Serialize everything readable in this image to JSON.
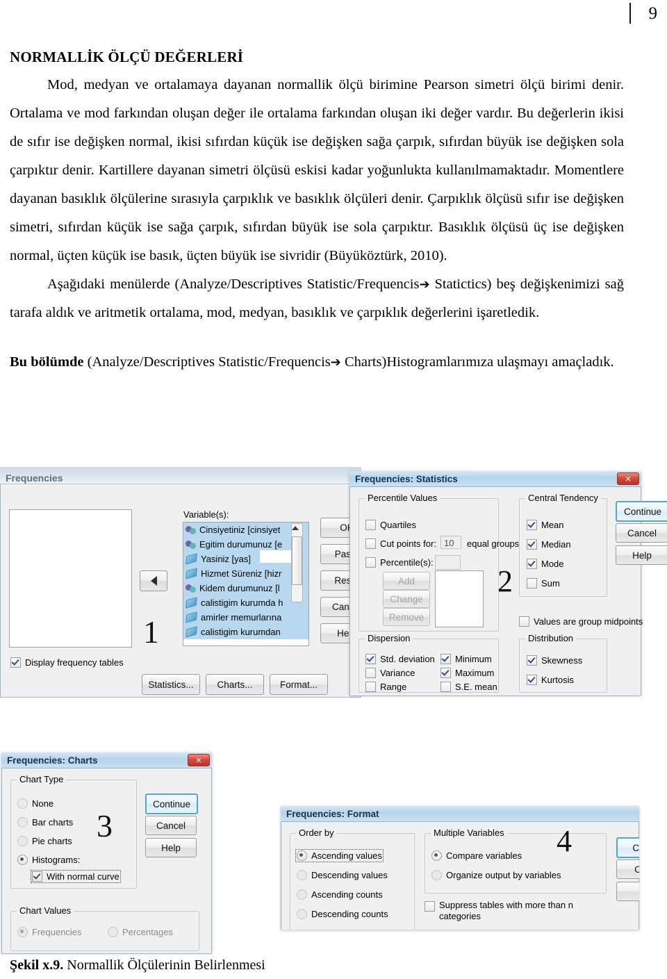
{
  "page": {
    "number": "9"
  },
  "document": {
    "title": "NORMALLİK ÖLÇÜ DEĞERLERİ",
    "paragraph1": "Mod, medyan ve ortalamaya dayanan normallik ölçü birimine Pearson simetri ölçü birimi denir. Ortalama ve mod farkından oluşan değer ile ortalama farkından oluşan iki değer vardır. Bu değerlerin ikisi de sıfır ise değişken normal, ikisi sıfırdan küçük ise değişken sağa çarpık, sıfırdan büyük ise değişken sola çarpıktır denir. Kartillere dayanan simetri ölçüsü eskisi kadar yoğunlukta kullanılmamaktadır. Momentlere dayanan basıklık ölçülerine sırasıyla çarpıklık ve basıklık ölçüleri denir. Çarpıklık ölçüsü sıfır ise değişken simetri, sıfırdan küçük ise sağa çarpık, sıfırdan büyük ise sola çarpıktır. Basıklık ölçüsü üç ise değişken normal, üçten küçük ise basık, üçten büyük ise sivridir (Büyüköztürk, 2010).",
    "paragraph2_part1": "Aşağıdaki menülerde (Analyze/Descriptives Statistic/Frequencis",
    "paragraph2_arrow": "➔",
    "paragraph2_part2": " Statictics) beş değişkenimizi sağ tarafa aldık ve aritmetik ortalama, mod, medyan, basıklık ve çarpıklık değerlerini işaretledik.",
    "paragraph3_bold": "Bu bölümde",
    "paragraph3_part1": " (Analyze/Descriptives   Statistic/Frequencis",
    "paragraph3_arrow": "➔",
    "paragraph3_part2": "   Charts)Histogramlarımıza ulaşmayı amaçladık."
  },
  "caption": {
    "bold": "Şekil x.9.",
    "text": " Normallik Ölçülerinin Belirlenmesi"
  },
  "frequencies_dialog": {
    "title": "Frequencies",
    "marker": "1",
    "variables_label": "Variable(s):",
    "variables": [
      {
        "label": "Cinsiyetiniz [cinsiyet",
        "icon": "nominal-icon"
      },
      {
        "label": "Egitim durumunuz [e",
        "icon": "nominal-icon"
      },
      {
        "label": "Yasiniz [yas]",
        "icon": "scale-icon"
      },
      {
        "label": "Hizmet Süreniz [hizr",
        "icon": "scale-icon"
      },
      {
        "label": "Kidem durumunuz [l",
        "icon": "nominal-icon"
      },
      {
        "label": "calistigim kurumda h",
        "icon": "scale-icon"
      },
      {
        "label": "amirler memurlarına",
        "icon": "scale-icon"
      },
      {
        "label": "calistigim kurumdan",
        "icon": "scale-icon"
      }
    ],
    "display_frequency_tables": {
      "label": "Display frequency tables",
      "checked": true
    },
    "side_buttons": [
      {
        "label": "OK"
      },
      {
        "label": "Paste"
      },
      {
        "label": "Reset"
      },
      {
        "label": "Cancel"
      },
      {
        "label": "Help"
      }
    ],
    "bottom_buttons": [
      {
        "label": "Statistics..."
      },
      {
        "label": "Charts..."
      },
      {
        "label": "Format..."
      }
    ]
  },
  "statistics_dialog": {
    "title": "Frequencies: Statistics",
    "marker": "2",
    "close_label": "✕",
    "percentile_values": {
      "group_label": "Percentile Values",
      "quartiles": {
        "label": "Quartiles",
        "checked": false
      },
      "cut_points": {
        "label": "Cut points for:",
        "value": "10",
        "suffix": "equal groups",
        "checked": false
      },
      "percentiles": {
        "label": "Percentile(s):",
        "value": "",
        "checked": false
      },
      "add_label": "Add",
      "change_label": "Change",
      "remove_label": "Remove"
    },
    "central_tendency": {
      "group_label": "Central Tendency",
      "items": [
        {
          "label": "Mean",
          "checked": true
        },
        {
          "label": "Median",
          "checked": true
        },
        {
          "label": "Mode",
          "checked": true
        },
        {
          "label": "Sum",
          "checked": false
        }
      ]
    },
    "group_midpoints": {
      "label": "Values are group midpoints",
      "checked": false
    },
    "dispersion": {
      "group_label": "Dispersion",
      "items": [
        {
          "label": "Std. deviation",
          "checked": true
        },
        {
          "label": "Variance",
          "checked": false
        },
        {
          "label": "Range",
          "checked": false
        },
        {
          "label": "Minimum",
          "checked": true
        },
        {
          "label": "Maximum",
          "checked": true
        },
        {
          "label": "S.E. mean",
          "checked": false
        }
      ]
    },
    "distribution": {
      "group_label": "Distribution",
      "items": [
        {
          "label": "Skewness",
          "checked": true
        },
        {
          "label": "Kurtosis",
          "checked": true
        }
      ]
    },
    "buttons": [
      {
        "label": "Continue",
        "primary": true
      },
      {
        "label": "Cancel",
        "primary": false
      },
      {
        "label": "Help",
        "primary": false
      }
    ]
  },
  "charts_dialog": {
    "title": "Frequencies: Charts",
    "marker": "3",
    "close_label": "✕",
    "chart_type": {
      "group_label": "Chart Type",
      "options": [
        {
          "label": "None",
          "selected": false
        },
        {
          "label": "Bar charts",
          "selected": false
        },
        {
          "label": "Pie charts",
          "selected": false
        },
        {
          "label": "Histograms:",
          "selected": true
        }
      ],
      "with_normal_curve": {
        "label": "With normal curve",
        "checked": true
      }
    },
    "chart_values": {
      "group_label": "Chart Values",
      "options": [
        {
          "label": "Frequencies",
          "selected": true
        },
        {
          "label": "Percentages",
          "selected": false
        }
      ]
    },
    "buttons": [
      {
        "label": "Continue",
        "primary": true
      },
      {
        "label": "Cancel",
        "primary": false
      },
      {
        "label": "Help",
        "primary": false
      }
    ]
  },
  "format_dialog": {
    "title": "Frequencies: Format",
    "marker": "4",
    "order_by": {
      "group_label": "Order by",
      "options": [
        {
          "label": "Ascending values",
          "selected": true
        },
        {
          "label": "Descending values",
          "selected": false
        },
        {
          "label": "Ascending counts",
          "selected": false
        },
        {
          "label": "Descending counts",
          "selected": false
        }
      ]
    },
    "multiple_variables": {
      "group_label": "Multiple Variables",
      "options": [
        {
          "label": "Compare variables",
          "selected": true
        },
        {
          "label": "Organize output by variables",
          "selected": false
        }
      ],
      "suppress": {
        "label": "Suppress tables with more than n categories",
        "checked": false
      }
    },
    "buttons": [
      {
        "label": "Co",
        "primary": true
      },
      {
        "label": "C",
        "primary": false
      },
      {
        "label": "",
        "primary": false
      }
    ]
  }
}
